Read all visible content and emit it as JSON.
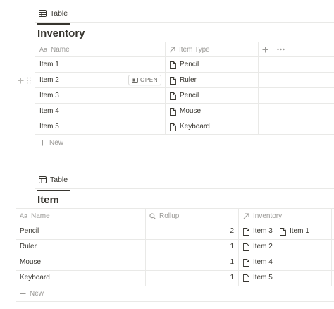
{
  "inventory_db": {
    "view_tab": {
      "label": "Table",
      "icon": "table-icon"
    },
    "title": "Inventory",
    "columns": [
      {
        "label": "Name",
        "icon": "text-property-icon"
      },
      {
        "label": "Item Type",
        "icon": "relation-arrow-icon"
      }
    ],
    "add_column_icon": "plus-icon",
    "more_icon": "more-dots-icon",
    "rows": [
      {
        "name": "Item 1",
        "item_type": "Pencil"
      },
      {
        "name": "Item 2",
        "item_type": "Ruler"
      },
      {
        "name": "Item 3",
        "item_type": "Pencil"
      },
      {
        "name": "Item 4",
        "item_type": "Mouse"
      },
      {
        "name": "Item 5",
        "item_type": "Keyboard"
      }
    ],
    "open_button": {
      "label": "OPEN",
      "icon": "open-sidepeek-icon"
    },
    "new_label": "New"
  },
  "item_db": {
    "view_tab": {
      "label": "Table",
      "icon": "table-icon"
    },
    "title": "Item",
    "columns": [
      {
        "label": "Name",
        "icon": "text-property-icon"
      },
      {
        "label": "Rollup",
        "icon": "search-rollup-icon"
      },
      {
        "label": "Inventory",
        "icon": "relation-arrow-icon"
      }
    ],
    "rows": [
      {
        "name": "Pencil",
        "rollup": "2",
        "inventory": [
          "Item 3",
          "Item 1"
        ]
      },
      {
        "name": "Ruler",
        "rollup": "1",
        "inventory": [
          "Item 2"
        ]
      },
      {
        "name": "Mouse",
        "rollup": "1",
        "inventory": [
          "Item 4"
        ]
      },
      {
        "name": "Keyboard",
        "rollup": "1",
        "inventory": [
          "Item 5"
        ]
      }
    ],
    "new_label": "New"
  }
}
